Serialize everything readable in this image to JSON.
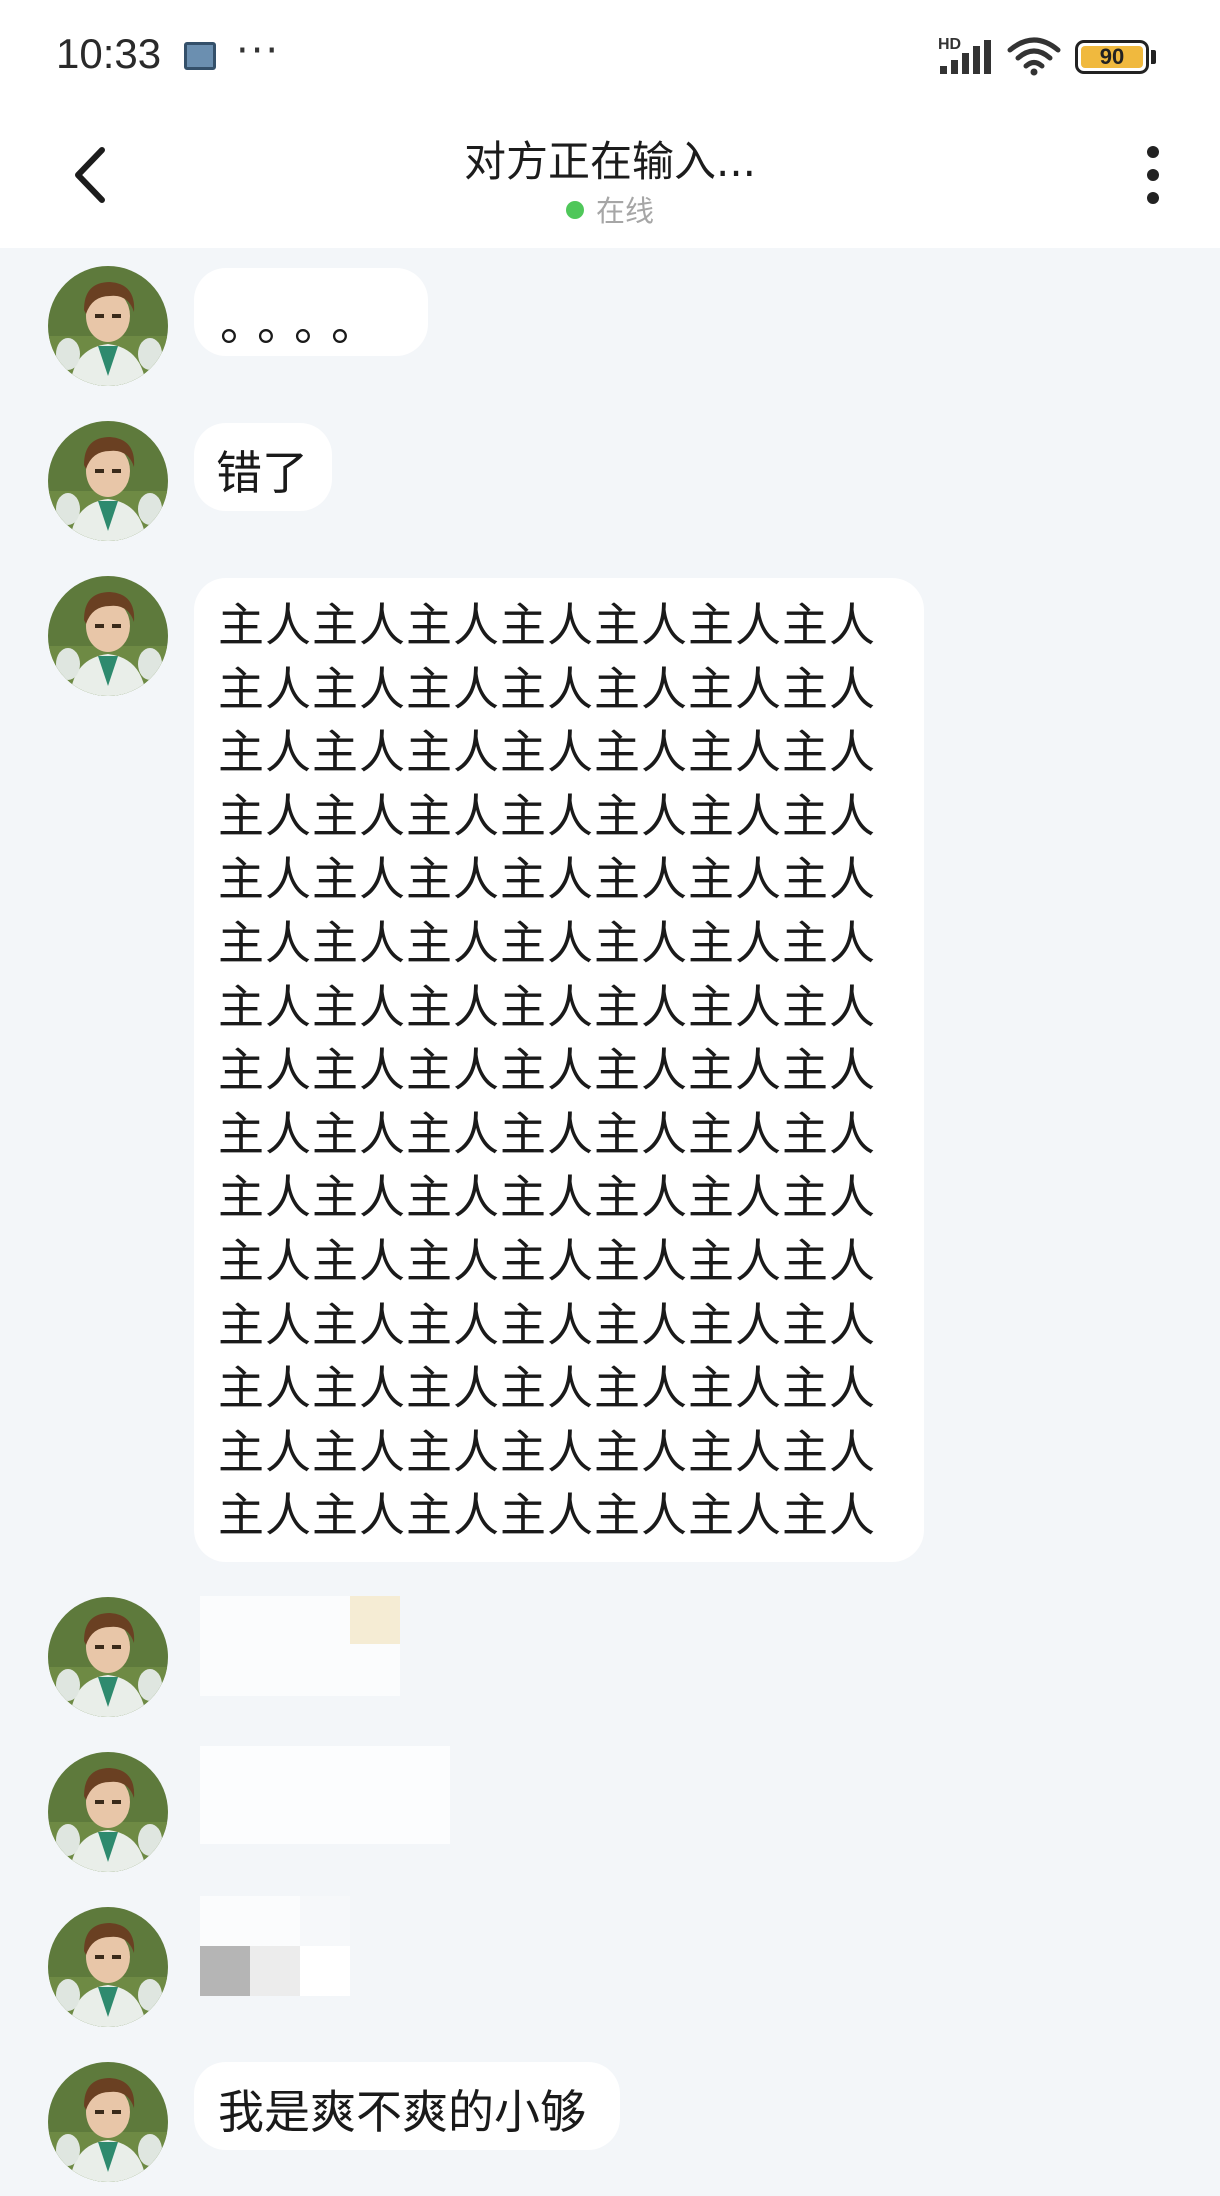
{
  "status_bar": {
    "time": "10:33",
    "dots": "···",
    "network": "HD",
    "battery": "90"
  },
  "header": {
    "title": "对方正在输入...",
    "status": "在线"
  },
  "messages": [
    {
      "text": "。。。。"
    },
    {
      "text": "错了"
    },
    {
      "text": "主人主人主人主人主人主人主人主人主人主人主人主人主人主人主人主人主人主人主人主人主人主人主人主人主人主人主人主人主人主人主人主人主人主人主人主人主人主人主人主人主人主人主人主人主人主人主人主人主人主人主人主人主人主人主人主人主人主人主人主人主人主人主人主人主人主人主人主人主人主人主人主人主人主人主人主人主人主人主人主人主人主人主人主人主人主人主人主人主人主人主人主人主人主人主人主人主人主人主人主人主人主人主人主人主人"
    },
    {
      "text": ""
    },
    {
      "text": ""
    },
    {
      "text": ""
    },
    {
      "text": "我是爽不爽的小够"
    }
  ],
  "colors": {
    "online_dot": "#4fc75a",
    "battery": "#f0b93e",
    "chat_bg": "#f3f6f9"
  }
}
